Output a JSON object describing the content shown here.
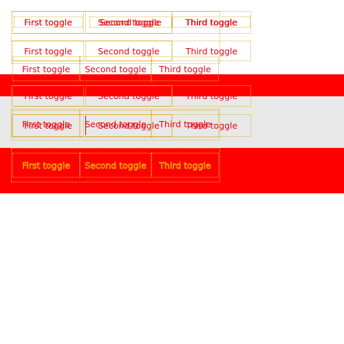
{
  "colors": {
    "red": "#ff0000",
    "gray": "#e8e8e8",
    "text_red": "#e3060f",
    "text_yellow": "#f1e200",
    "dotted_border": "#d6b23a"
  },
  "toggles": {
    "first": "First toggle",
    "second": "Second toggle",
    "third": "Third toggle"
  }
}
